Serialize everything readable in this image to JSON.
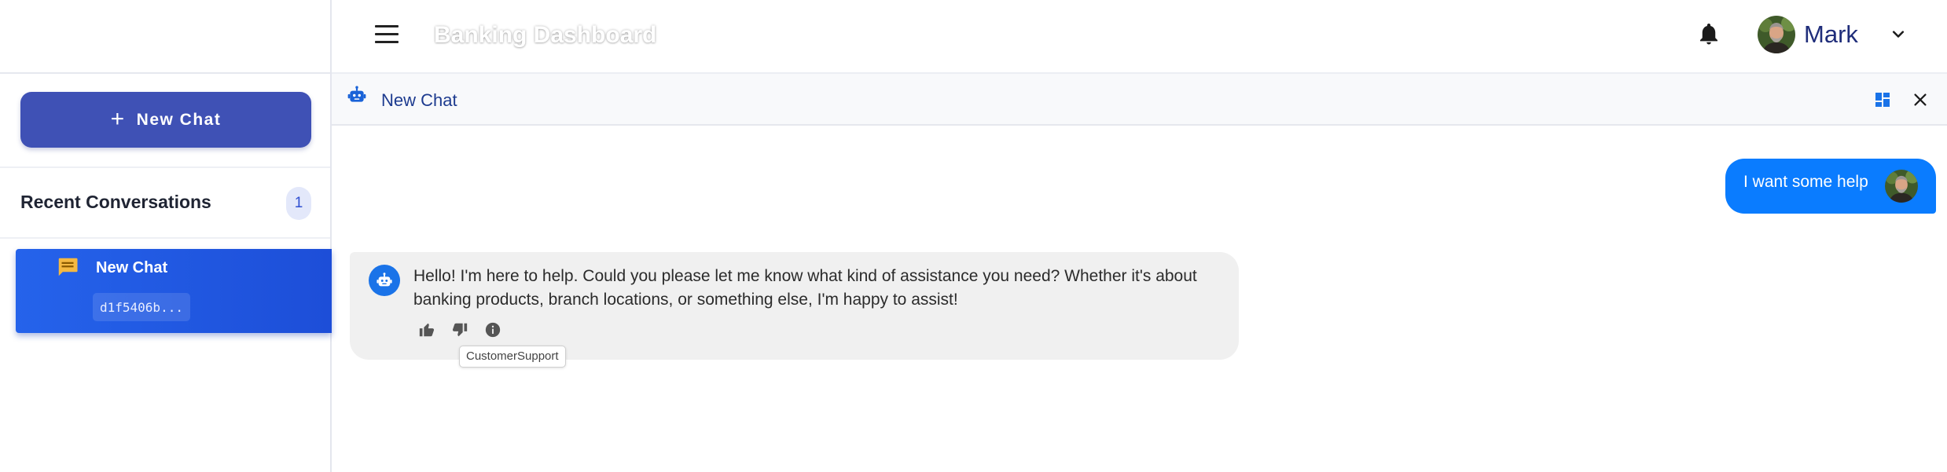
{
  "header": {
    "app_title": "Banking Dashboard",
    "user_name": "Mark"
  },
  "sidebar": {
    "new_chat_label": "New Chat",
    "recent_title": "Recent Conversations",
    "recent_count": "1",
    "conversations": [
      {
        "title": "New Chat",
        "id": "d1f5406b..."
      }
    ]
  },
  "chat": {
    "title": "New Chat",
    "messages": [
      {
        "role": "user",
        "text": "I want some help"
      },
      {
        "role": "bot",
        "text": "Hello! I'm here to help. Could you please let me know what kind of assistance you need? Whether it's about banking products, branch locations, or something else, I'm happy to assist!"
      }
    ],
    "tooltip": "CustomerSupport"
  },
  "colors": {
    "primary_button": "#3f51b5",
    "active_conversation": "#2563eb",
    "user_bubble": "#0a7cff",
    "bot_bubble": "#f0f0f0",
    "bot_avatar": "#1a73e8"
  },
  "icons": [
    "menu-icon",
    "bell-icon",
    "chevron-down-icon",
    "bot-icon",
    "grid-view-icon",
    "close-icon",
    "chat-bubble-icon",
    "thumbs-up-icon",
    "thumbs-down-icon",
    "info-icon",
    "plus-icon"
  ]
}
